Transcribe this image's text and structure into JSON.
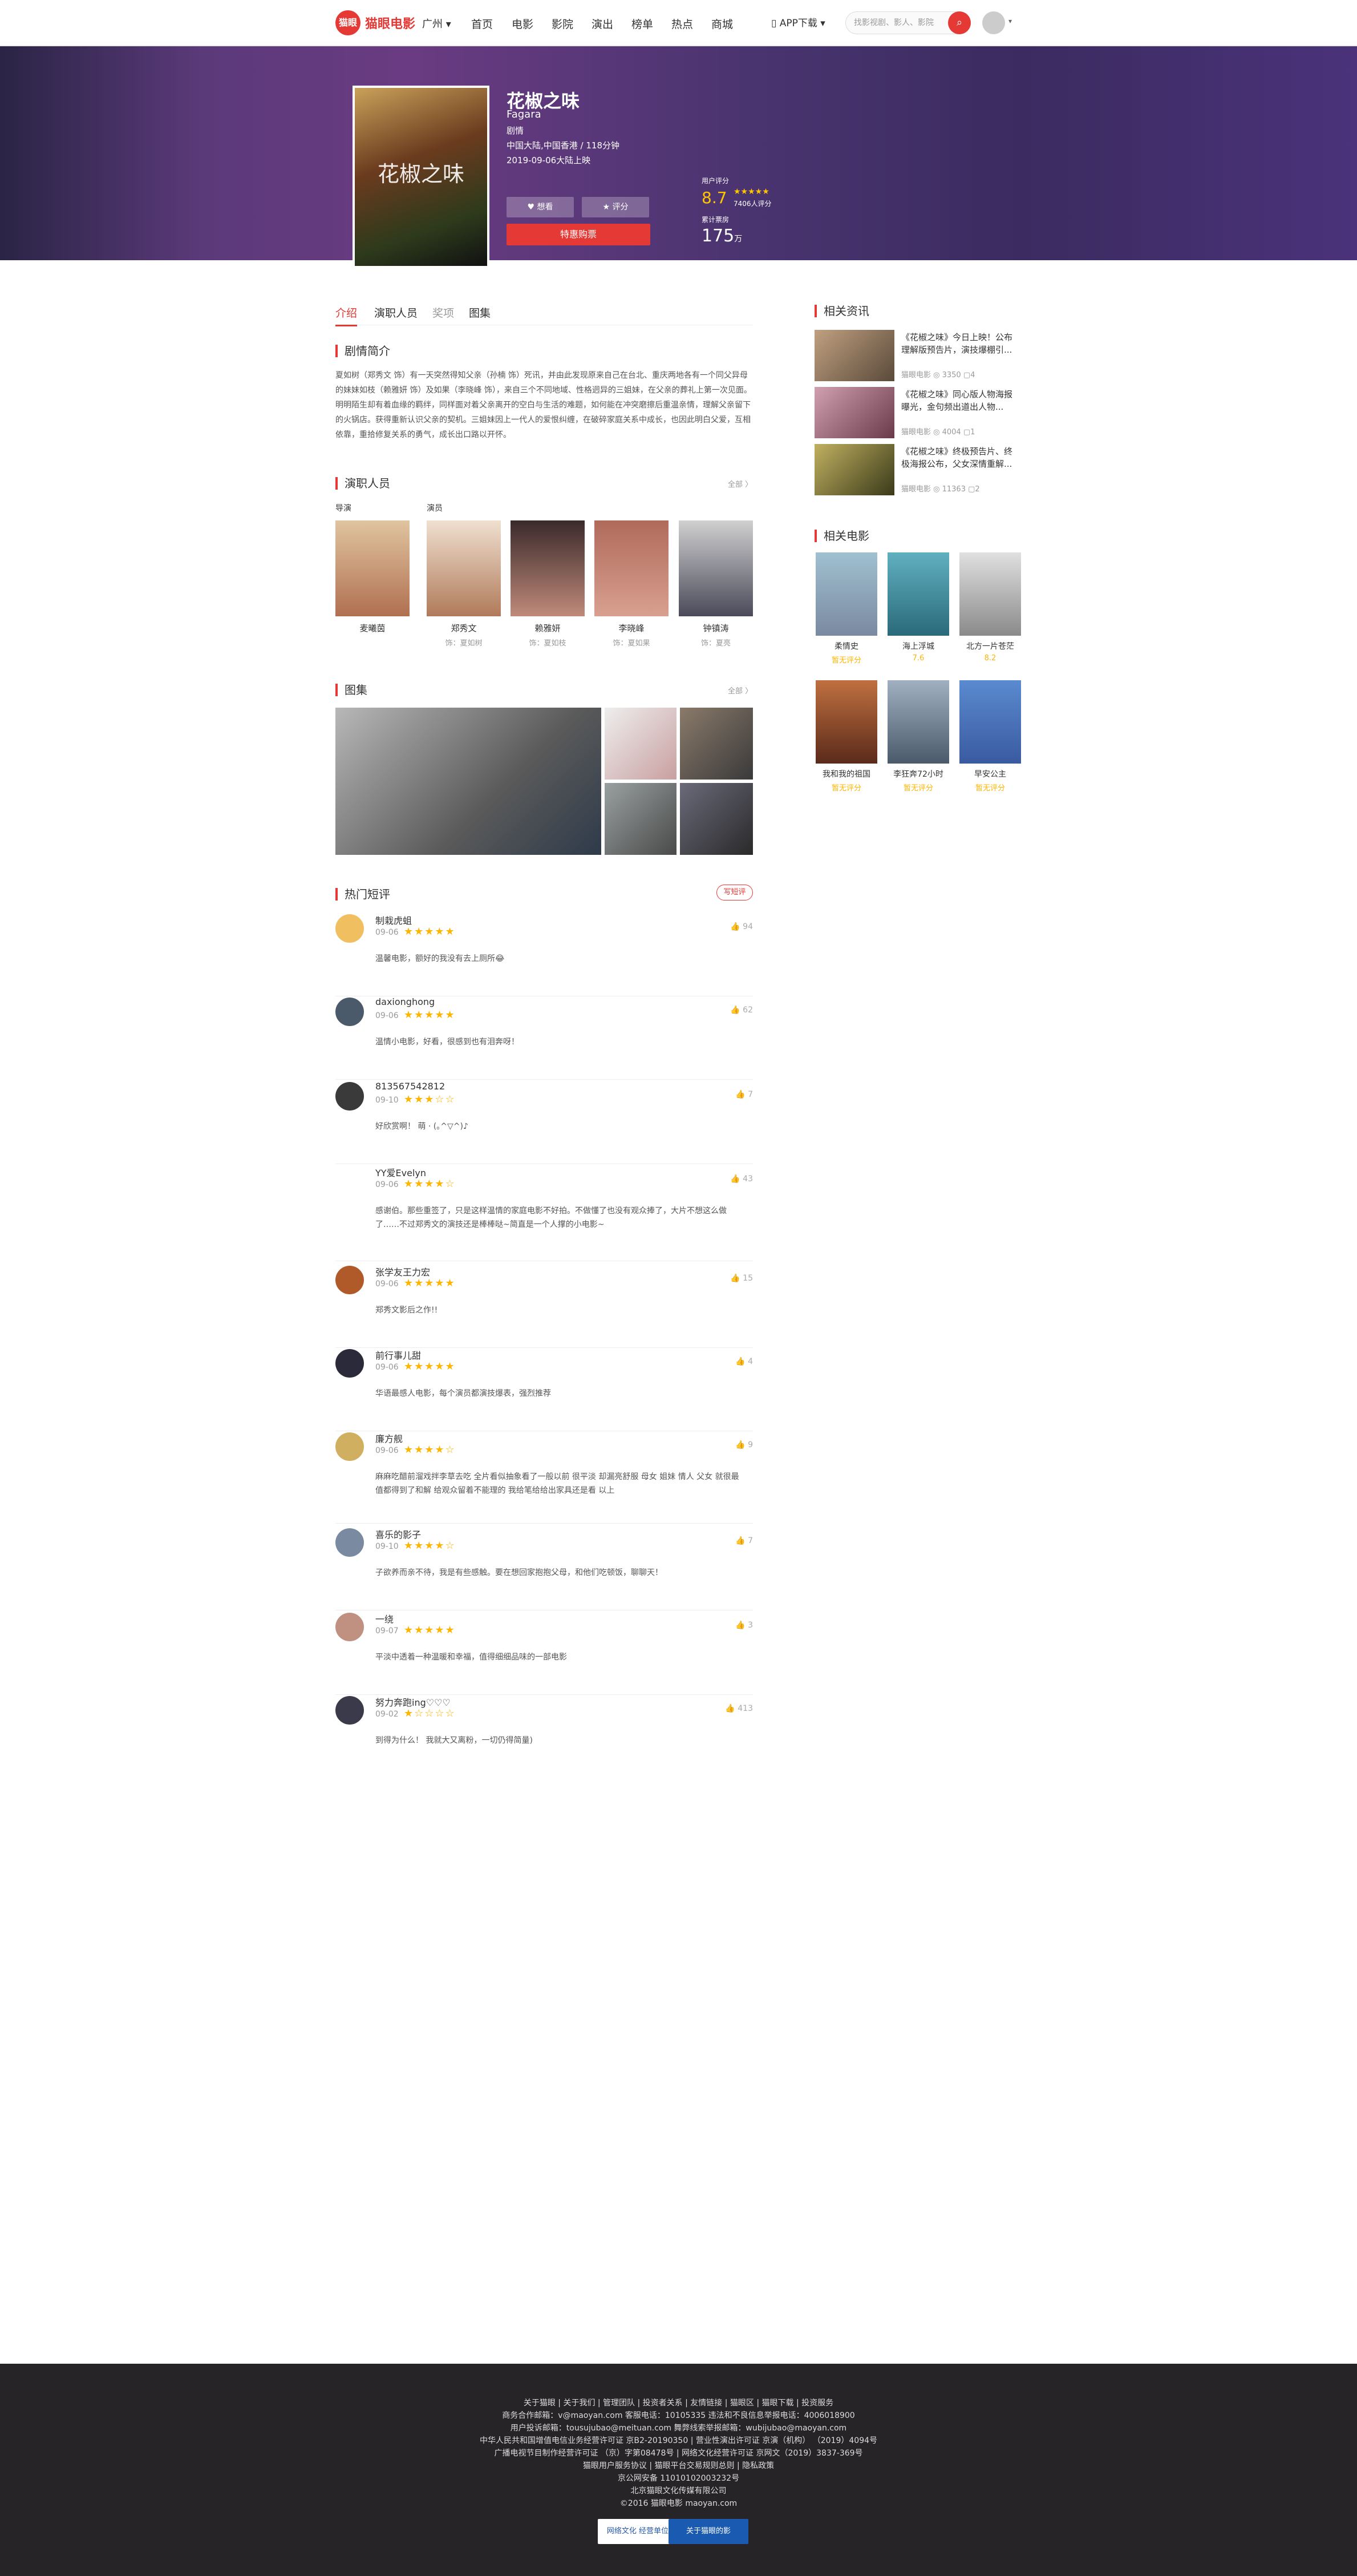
{
  "header": {
    "logo_text": "猫眼",
    "brand": "猫眼电影",
    "city": "广州 ▾",
    "nav": [
      "首页",
      "电影",
      "影院",
      "演出",
      "榜单",
      "热点",
      "商城"
    ],
    "app_download": "APP下载 ▾",
    "search_placeholder": "找影视剧、影人、影院"
  },
  "movie": {
    "title": "花椒之味",
    "english_title": "Fagara",
    "poster_text": "花椒之味",
    "genre": "剧情",
    "region_duration": "中国大陆,中国香港 / 118分钟",
    "release": "2019-09-06大陆上映",
    "want_button": "♥ 想看",
    "rate_button": "★ 评分",
    "buy_button": "特惠购票",
    "rating_label": "用户评分",
    "rating": "8.7",
    "rating_stars": "★★★★★",
    "rating_count": "7406人评分",
    "box_label": "累计票房",
    "box_value": "175",
    "box_unit": "万"
  },
  "tabs": [
    "介绍",
    "演职人员",
    "奖项",
    "图集"
  ],
  "synopsis": {
    "heading": "剧情简介",
    "text": "夏如树（郑秀文 饰）有一天突然得知父亲（孙楠 饰）死讯，并由此发现原来自己在台北、重庆两地各有一个同父异母的妹妹如枝（赖雅妍 饰）及如果（李晓峰 饰），来自三个不同地域、性格迥异的三姐妹，在父亲的葬礼上第一次见面。明明陌生却有着血缘的羁绊，同样面对着父亲离开的空白与生活的难题，如何能在冲突磨擦后重温亲情，理解父亲留下的火锅店。获得重新认识父亲的契机。三姐妹因上一代人的爱恨纠缠，在破碎家庭关系中成长，也因此明白父爱，互相依靠，重拾修复关系的勇气，成长出口路以开怀。"
  },
  "cast": {
    "heading": "演职人员",
    "more": "全部 〉",
    "director_label": "导演",
    "actor_label": "演员",
    "people": [
      {
        "name": "麦曦茵",
        "role": ""
      },
      {
        "name": "郑秀文",
        "role": "饰：夏如树"
      },
      {
        "name": "赖雅妍",
        "role": "饰：夏如枝"
      },
      {
        "name": "李晓峰",
        "role": "饰：夏如果"
      },
      {
        "name": "钟镇涛",
        "role": "饰：夏亮"
      }
    ]
  },
  "gallery": {
    "heading": "图集",
    "more": "全部 〉"
  },
  "comments": {
    "heading": "热门短评",
    "write": "写短评",
    "items": [
      {
        "user": "制栽虎蛆",
        "date": "09-06",
        "stars": "★★★★★",
        "likes": "94",
        "text": "温馨电影，额好的我没有去上厕所😂"
      },
      {
        "user": "daxionghong",
        "date": "09-06",
        "stars": "★★★★★",
        "likes": "62",
        "text": "温情小电影，好看，很感到也有泪奔呀！"
      },
      {
        "user": "813567542812",
        "date": "09-10",
        "stars": "★★★☆☆",
        "likes": "7",
        "text": "好欣赏啊！ 萌 · (｡^▽^)♪"
      },
      {
        "user": "YY爱Evelyn",
        "date": "09-06",
        "stars": "★★★★☆",
        "likes": "43",
        "text": "感谢伯。那些重签了，只是这样温情的家庭电影不好拍。不做懂了也没有观众捧了，大片不想这么做了……不过郑秀文的演技还是棒棒哒~简直是一个人撑的小电影~"
      },
      {
        "user": "张学友王力宏",
        "date": "09-06",
        "stars": "★★★★★",
        "likes": "15",
        "text": "郑秀文影后之作!!"
      },
      {
        "user": "前行事儿甜",
        "date": "09-06",
        "stars": "★★★★★",
        "likes": "4",
        "text": "华语最感人电影，每个演员都演技爆表，强烈推荐"
      },
      {
        "user": "廉方舰",
        "date": "09-06",
        "stars": "★★★★☆",
        "likes": "9",
        "text": "麻麻吃醋前溜戏拌李草去吃 全片看似抽象看了一般以前 很平淡 却漏亮舒服 母女 姐妹 情人 父女 就很最值都得到了和解 给观众留着不能理的 我给笔给给出家具还是看 以上"
      },
      {
        "user": "喜乐的影子",
        "date": "09-10",
        "stars": "★★★★☆",
        "likes": "7",
        "text": "子欲养而亲不待，我是有些感触。要在想回家抱抱父母，和他们吃顿饭，聊聊天！"
      },
      {
        "user": "一绕",
        "date": "09-07",
        "stars": "★★★★★",
        "likes": "3",
        "text": "平淡中透着一种温暖和幸福，值得细细品味的一部电影"
      },
      {
        "user": "努力奔跑ing♡♡♡",
        "date": "09-02",
        "stars": "★☆☆☆☆",
        "likes": "413",
        "text": "到得为什么！ 我就大又离粉，一切仍得简量)"
      }
    ]
  },
  "news": {
    "heading": "相关资讯",
    "items": [
      {
        "title": "《花椒之味》今日上映！公布理解版预告片，演技爆棚引...",
        "meta": "猫眼电影  ◎ 3350 ▢4"
      },
      {
        "title": "《花椒之味》同心版人物海报曝光，金句频出道出人物...",
        "meta": "猫眼电影  ◎ 4004 ▢1"
      },
      {
        "title": "《花椒之味》终极预告片、终极海报公布，父女深情重解...",
        "meta": "猫眼电影  ◎ 11363 ▢2"
      }
    ]
  },
  "related": {
    "heading": "相关电影",
    "items": [
      {
        "name": "柔情史",
        "score": "暂无评分"
      },
      {
        "name": "海上浮城",
        "score": "7.6"
      },
      {
        "name": "北方一片苍茫",
        "score": "8.2"
      },
      {
        "name": "我和我的祖国",
        "score": "暂无评分"
      },
      {
        "name": "李狂奔72小时",
        "score": "暂无评分"
      },
      {
        "name": "早安公主",
        "score": "暂无评分"
      }
    ]
  },
  "footer": {
    "line1": "关于猫眼 | 关于我们 | 管理团队 | 投资者关系 | 友情链接 | 猫眼区 | 猫眼下载 | 投资服务",
    "line2": "商务合作邮箱：v@maoyan.com 客服电话：10105335 违法和不良信息举报电话：4006018900",
    "line3": "用户投诉邮箱：tousujubao@meituan.com 舞弊线索举报邮箱：wubijubao@maoyan.com",
    "line4": "中华人民共和国增值电信业务经营许可证 京B2-20190350 | 营业性演出许可证 京演（机构） （2019）4094号",
    "line5": "广播电视节目制作经营许可证 （京）字第08478号 | 网络文化经营许可证 京网文（2019）3837-369号",
    "line6": "猫眼用户服务协议 | 猫眼平台交易规则总则 | 隐私政策",
    "line7": "京公网安备 11010102003232号",
    "line8": "北京猫眼文化传媒有限公司",
    "line9": "©2016 猫眼电影 maoyan.com",
    "badge1": "网络文化 经营单位",
    "badge2": "关于猫眼的影"
  },
  "colors": {
    "accent": "#e53935",
    "star": "#ffb400",
    "banner": "#4a3470"
  }
}
